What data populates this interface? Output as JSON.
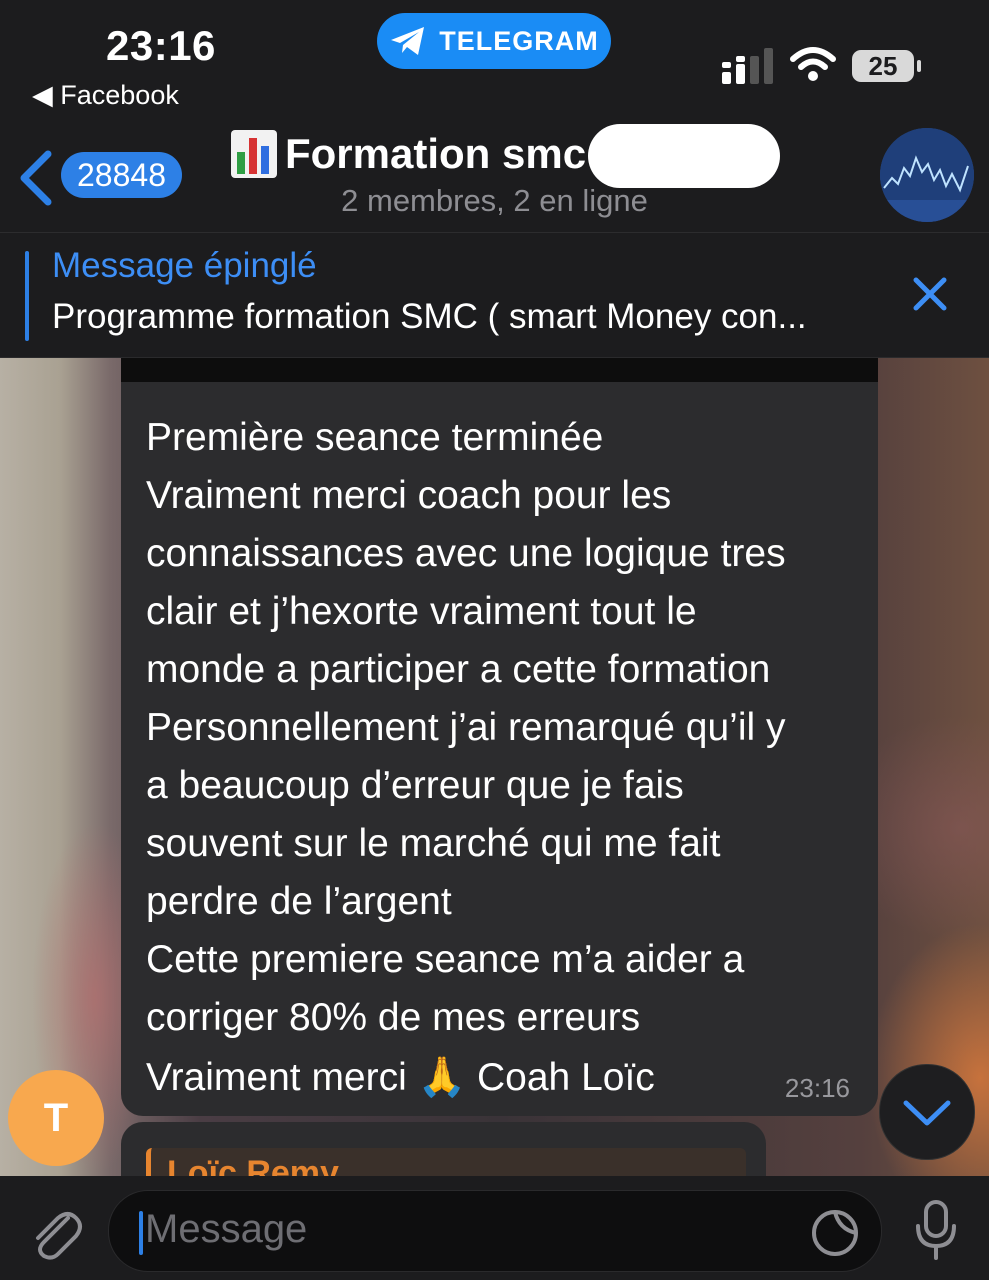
{
  "status_bar": {
    "time": "23:16",
    "back_app": "◀ Facebook",
    "app_pill": "TELEGRAM",
    "battery": "25"
  },
  "header": {
    "unread_count": "28848",
    "title": "Formation smc",
    "subtitle": "2 membres, 2 en ligne"
  },
  "pinned": {
    "title": "Message épinglé",
    "text": "Programme formation SMC ( smart Money con..."
  },
  "messages": [
    {
      "lines": [
        "Première seance terminée",
        "Vraiment merci coach pour les",
        "connaissances avec une logique tres",
        "clair et j’hexorte vraiment tout le",
        "monde a participer a cette formation",
        "Personnellement j’ai remarqué qu’il y",
        "a beaucoup d’erreur que je fais",
        "souvent sur le marché qui me fait",
        "perdre de l’argent",
        "Cette premiere seance m’a aider a",
        "corriger 80% de mes erreurs",
        "Vraiment merci 🙏 Coah Loïc"
      ],
      "time": "23:16"
    },
    {
      "reply_name": "Loïc Remy"
    }
  ],
  "sender_avatar_letter": "T",
  "input": {
    "placeholder": "Message"
  },
  "icons": [
    "telegram-plane-icon",
    "signal-bars-icon",
    "wifi-icon",
    "battery-icon",
    "back-chevron-icon",
    "bar-chart-emoji-icon",
    "close-icon",
    "chevron-down-icon",
    "paperclip-icon",
    "sticker-icon",
    "microphone-icon"
  ],
  "colors": {
    "accent": "#2d80e6",
    "telegram_pill": "#1a8cf5",
    "avatar_orange": "#f8a84e",
    "reply_orange": "#e7852f"
  }
}
